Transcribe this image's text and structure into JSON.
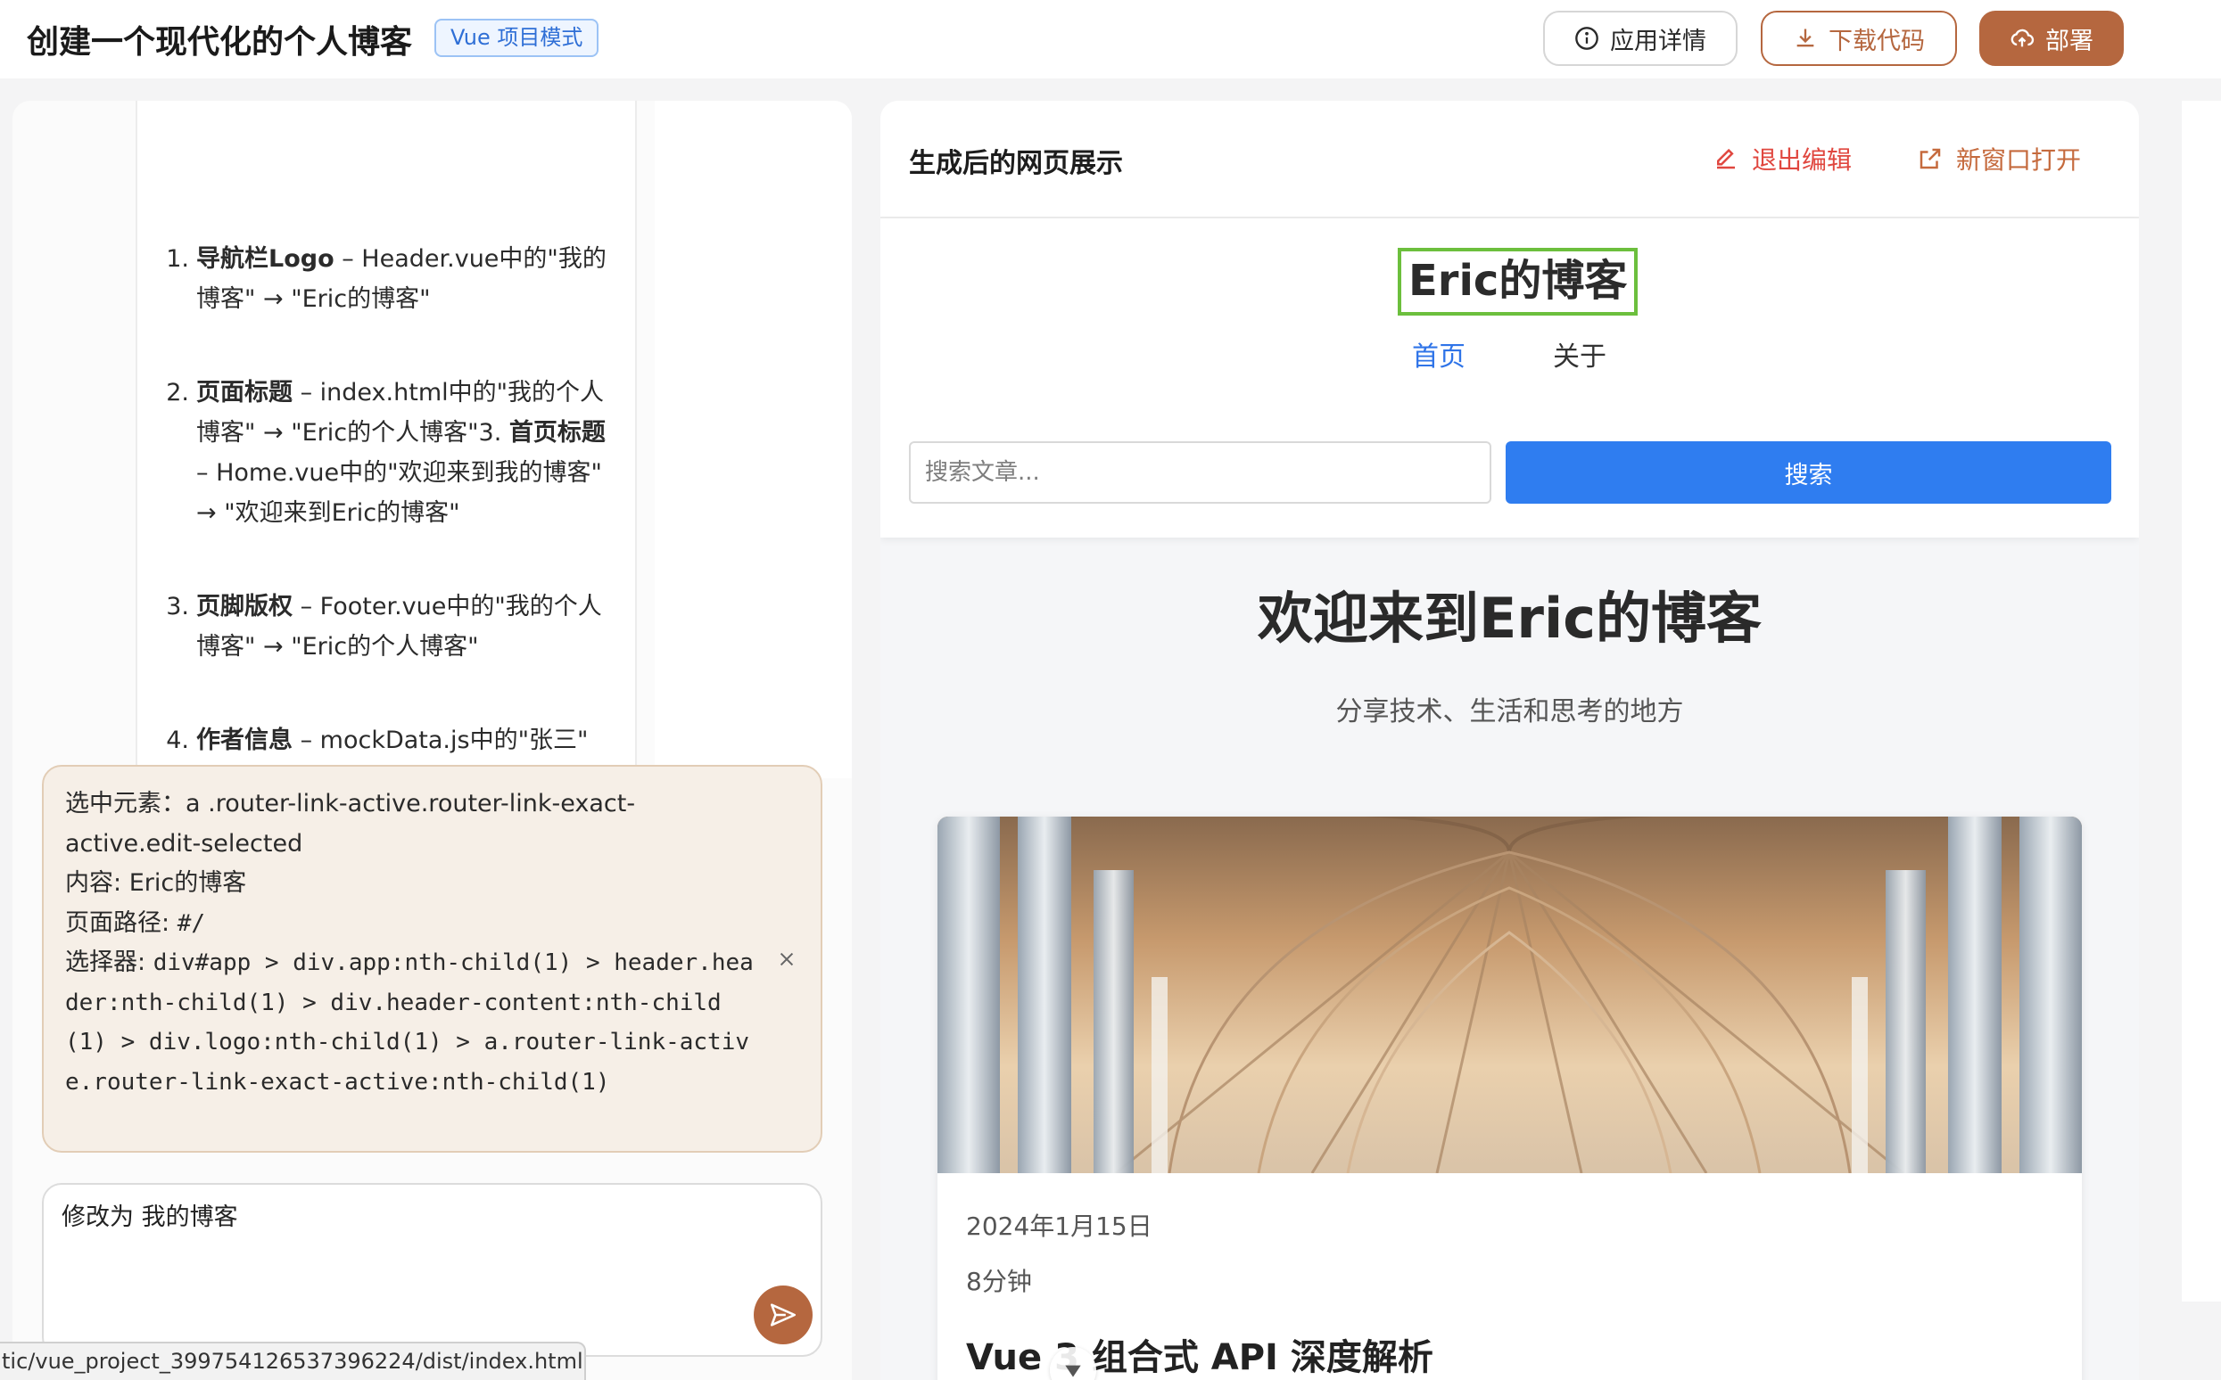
{
  "header": {
    "title": "创建一个现代化的个人博客",
    "mode_badge": "Vue 项目模式",
    "buttons": {
      "detail": "应用详情",
      "download": "下载代码",
      "deploy": "部署"
    }
  },
  "chat": {
    "changes": [
      {
        "num": "1.",
        "segments": [
          {
            "bold": true,
            "text": "导航栏Logo"
          },
          {
            "bold": false,
            "text": " – Header.vue中的\"我的博客\" → \"Eric的博客\""
          }
        ]
      },
      {
        "num": "2.",
        "segments": [
          {
            "bold": true,
            "text": "页面标题"
          },
          {
            "bold": false,
            "text": " – index.html中的\"我的个人博客\" → \"Eric的个人博客\"3. "
          },
          {
            "bold": true,
            "text": "首页标题"
          },
          {
            "bold": false,
            "text": " – Home.vue中的\"欢迎来到我的博客\" → \"欢迎来到Eric的博客\""
          }
        ]
      },
      {
        "num": "3.",
        "segments": [
          {
            "bold": true,
            "text": "页脚版权"
          },
          {
            "bold": false,
            "text": " – Footer.vue中的\"我的个人博客\" → \"Eric的个人博客\""
          }
        ]
      },
      {
        "num": "4.",
        "segments": [
          {
            "bold": true,
            "text": "作者信息"
          },
          {
            "bold": false,
            "text": " – mockData.js中的\"张三\""
          }
        ]
      }
    ],
    "selected_element": {
      "element_label": "选中元素：",
      "element_value": "a .router-link-active.router-link-exact-active.edit-selected",
      "content_label": "内容: ",
      "content_value": "Eric的博客",
      "path_label": "页面路径: ",
      "path_value": "#/",
      "selector_label": "选择器: ",
      "selector_value": "div#app > div.app:nth-child(1) > header.header:nth-child(1) > div.header-content:nth-child(1) > div.logo:nth-child(1) > a.router-link-active.router-link-exact-active:nth-child(1)"
    },
    "input_value": "修改为 我的博客",
    "status_url": "tic/vue_project_399754126537396224/dist/index.html#/"
  },
  "preview": {
    "title": "生成后的网页展示",
    "exit_edit": "退出编辑",
    "open_new": "新窗口打开",
    "site": {
      "logo": "Eric的博客",
      "nav": [
        "首页",
        "关于"
      ],
      "search_placeholder": "搜索文章...",
      "search_button": "搜索",
      "hero_title": "欢迎来到Eric的博客",
      "hero_subtitle": "分享技术、生活和思考的地方",
      "post": {
        "date": "2024年1月15日",
        "read_time": "8分钟",
        "title": "Vue 3 组合式 API 深度解析"
      }
    }
  },
  "colors": {
    "accent": "#b5673f",
    "link_blue": "#2f74e8",
    "danger": "#e0473f",
    "selected_outline": "#6cbf3d"
  }
}
